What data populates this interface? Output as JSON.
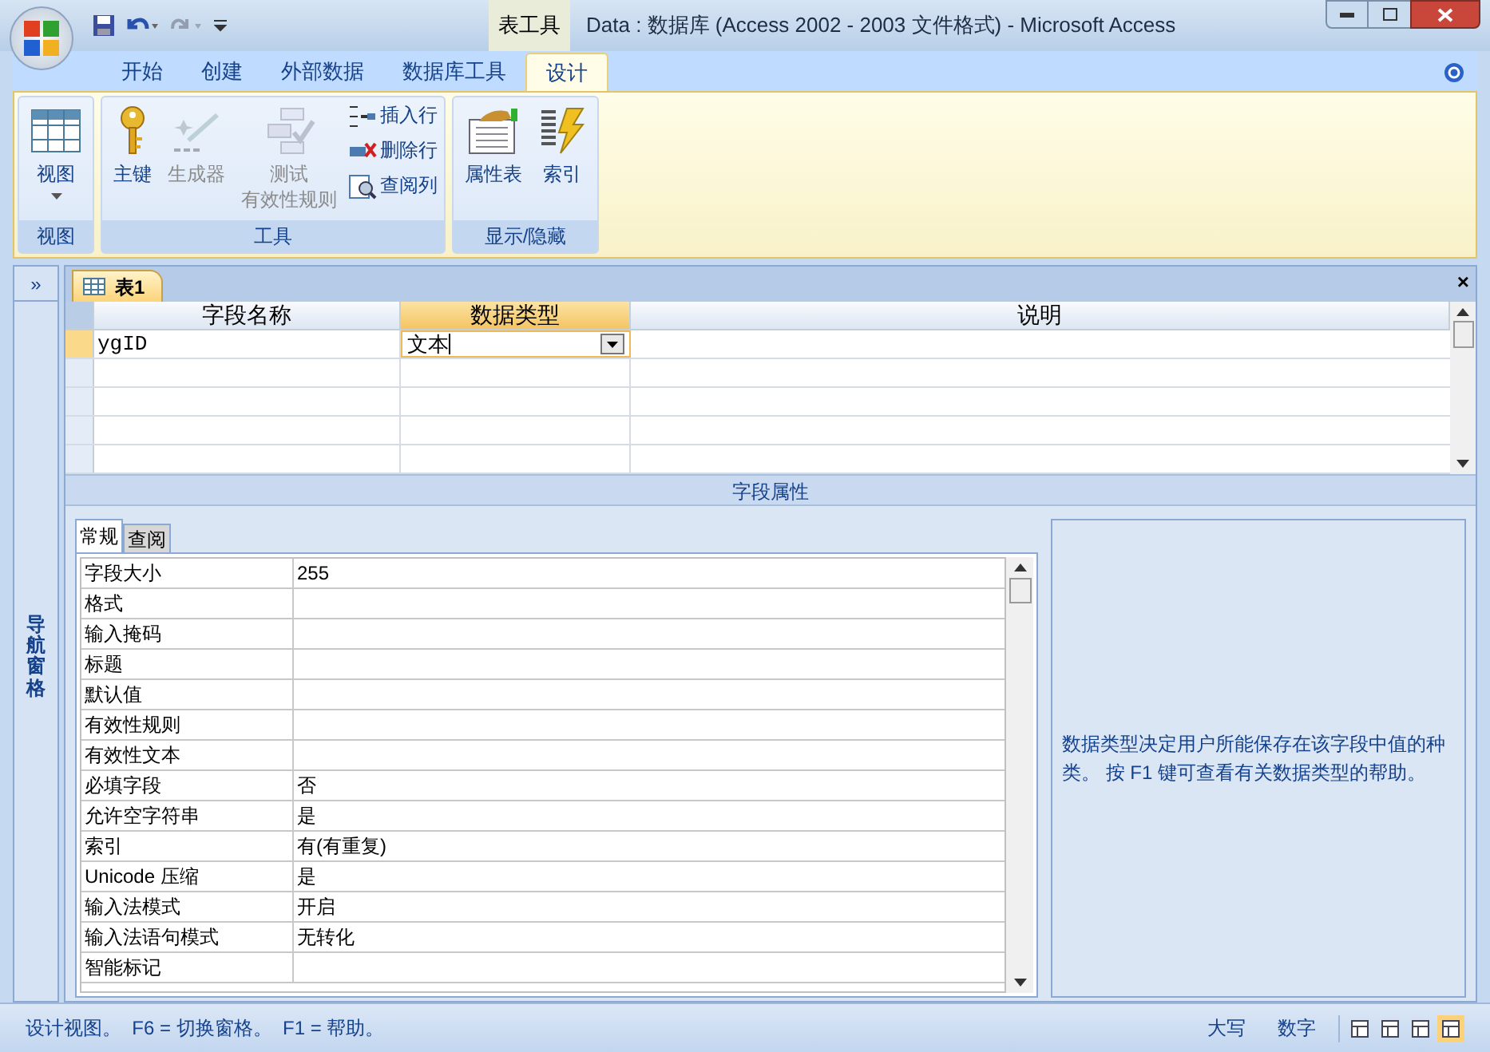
{
  "window": {
    "context_label": "表工具",
    "title": "Data : 数据库 (Access 2002 - 2003 文件格式) - Microsoft Access"
  },
  "ribbon_tabs": [
    {
      "label": "开始",
      "selected": false
    },
    {
      "label": "创建",
      "selected": false
    },
    {
      "label": "外部数据",
      "selected": false
    },
    {
      "label": "数据库工具",
      "selected": false
    },
    {
      "label": "设计",
      "selected": true
    }
  ],
  "ribbon_groups": [
    {
      "label": "视图",
      "items": [
        {
          "kind": "view",
          "label": "视图",
          "disabled": false
        }
      ]
    },
    {
      "label": "工具",
      "items": [
        {
          "kind": "key",
          "label": "主键",
          "disabled": false
        },
        {
          "kind": "builder",
          "label": "生成器",
          "disabled": true
        },
        {
          "kind": "validate",
          "label": "测试",
          "sublabel": "有效性规则",
          "disabled": true
        },
        {
          "kind": "small-stack",
          "children": [
            {
              "kind": "insert-row",
              "label": "插入行",
              "disabled": false
            },
            {
              "kind": "delete-row",
              "label": "删除行",
              "disabled": false
            },
            {
              "kind": "lookup",
              "label": "查阅列",
              "disabled": false
            }
          ]
        }
      ]
    },
    {
      "label": "显示/隐藏",
      "items": [
        {
          "kind": "property-sheet",
          "label": "属性表",
          "disabled": false
        },
        {
          "kind": "indexes",
          "label": "索引",
          "disabled": false
        }
      ]
    }
  ],
  "nav_pane": {
    "toggle": "»",
    "label": "导航窗格"
  },
  "document_tab": {
    "label": "表1",
    "close": "×"
  },
  "grid": {
    "columns": [
      {
        "label": "字段名称",
        "selected": false
      },
      {
        "label": "数据类型",
        "selected": true
      },
      {
        "label": "说明",
        "selected": false
      }
    ],
    "rows": [
      {
        "field_name": "ygID",
        "data_type": "文本",
        "selected": true
      }
    ]
  },
  "field_properties_label": "字段属性",
  "property_tabs": [
    {
      "label": "常规",
      "selected": true
    },
    {
      "label": "查阅",
      "selected": false
    }
  ],
  "properties": [
    {
      "name": "字段大小",
      "value": "255"
    },
    {
      "name": "格式"
    },
    {
      "name": "输入掩码"
    },
    {
      "name": "标题"
    },
    {
      "name": "默认值"
    },
    {
      "name": "有效性规则"
    },
    {
      "name": "有效性文本"
    },
    {
      "name": "必填字段",
      "value": "否"
    },
    {
      "name": "允许空字符串",
      "value": "是"
    },
    {
      "name": "索引",
      "value": "有(有重复)"
    },
    {
      "name": "Unicode 压缩",
      "value": "是"
    },
    {
      "name": "输入法模式",
      "value": "开启"
    },
    {
      "name": "输入法语句模式",
      "value": "无转化"
    },
    {
      "name": "智能标记"
    }
  ],
  "help_text": "数据类型决定用户所能保存在该字段中值的种类。 按 F1 键可查看有关数据类型的帮助。",
  "status_bar": {
    "text": "设计视图。  F6 = 切换窗格。  F1 = 帮助。",
    "indicators": [
      "大写",
      "数字"
    ]
  }
}
